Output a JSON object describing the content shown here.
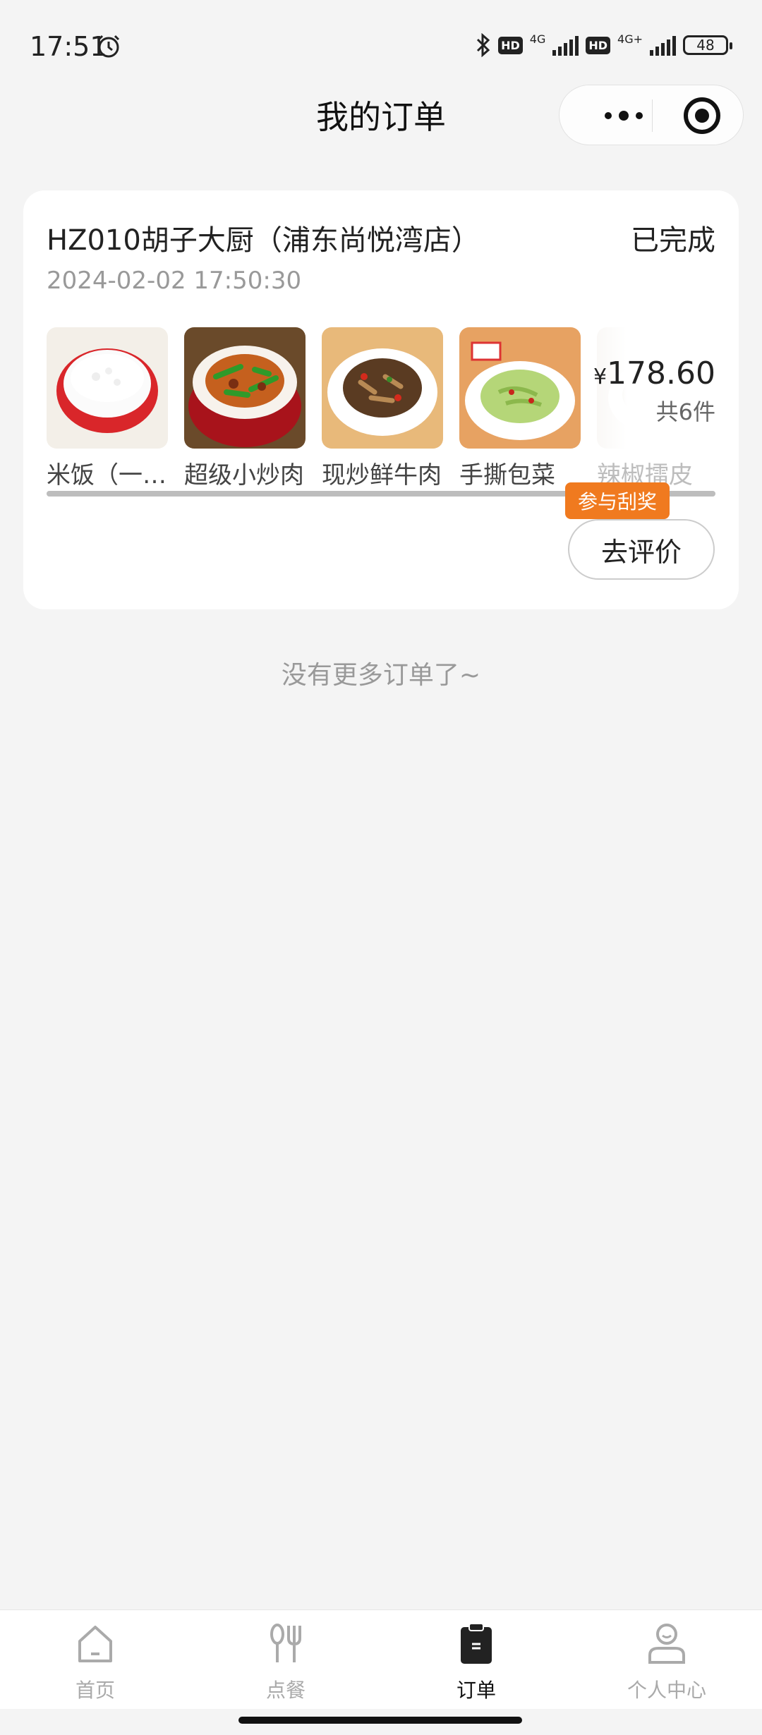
{
  "status_bar": {
    "time": "17:51",
    "hd1": "HD",
    "net1": "4G",
    "hd2": "HD",
    "net2": "4G+",
    "battery": "48"
  },
  "nav": {
    "title": "我的订单"
  },
  "order": {
    "shop_name": "HZ010胡子大厨（浦东尚悦湾店）",
    "status": "已完成",
    "time": "2024-02-02 17:50:30",
    "items": [
      {
        "name": "米饭（一…",
        "icon": "rice-bowl-image"
      },
      {
        "name": "超级小炒肉",
        "icon": "stir-fried-pork-image"
      },
      {
        "name": "现炒鲜牛肉",
        "icon": "fresh-beef-image"
      },
      {
        "name": "手撕包菜",
        "icon": "cabbage-image"
      },
      {
        "name": "辣椒擂皮",
        "icon": "pepper-dish-image"
      }
    ],
    "price_symbol": "¥",
    "price": "178.60",
    "count": "共6件",
    "promo_label": "参与刮奖",
    "review_button": "去评价"
  },
  "no_more_text": "没有更多订单了~",
  "tabbar": {
    "tabs": [
      {
        "label": "首页",
        "icon": "home-icon"
      },
      {
        "label": "点餐",
        "icon": "utensils-icon"
      },
      {
        "label": "订单",
        "icon": "clipboard-icon",
        "active": true
      },
      {
        "label": "个人中心",
        "icon": "user-icon"
      }
    ]
  },
  "colors": {
    "background": "#f4f4f4",
    "promo": "#f07a1f",
    "active_tab": "#111111",
    "inactive_tab": "#aaaaaa"
  }
}
